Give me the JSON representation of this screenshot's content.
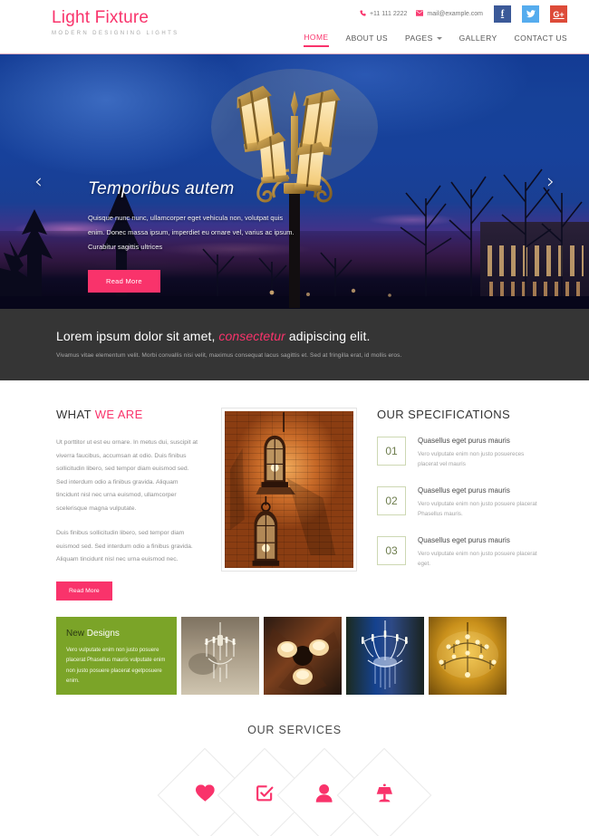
{
  "header": {
    "logo_title": "Light Fixture",
    "logo_tagline": "Modern Designing Lights",
    "phone": "+11 111 2222",
    "email": "mail@example.com",
    "phone_icon": "phone-icon",
    "email_icon": "envelope-icon",
    "social": [
      {
        "name": "facebook-icon",
        "glyph": "f"
      },
      {
        "name": "twitter-icon",
        "glyph": "ᵀ"
      },
      {
        "name": "google-plus-icon",
        "glyph": "G+"
      }
    ],
    "nav": [
      {
        "label": "HOME",
        "active": true
      },
      {
        "label": "ABOUT US",
        "active": false
      },
      {
        "label": "PAGES",
        "active": false,
        "has_dropdown": true
      },
      {
        "label": "GALLERY",
        "active": false
      },
      {
        "label": "CONTACT US",
        "active": false
      }
    ]
  },
  "slider": {
    "title": "Temporibus autem",
    "description": "Quisque nunc nunc, ullamcorper eget vehicula non, volutpat quis enim. Donec massa ipsum, imperdiet eu ornare vel, varius ac ipsum. Curabitur sagittis ultrices",
    "button": "Read More",
    "prev_arrow": "‹",
    "next_arrow": "›"
  },
  "banner": {
    "title_part1": "Lorem ipsum dolor sit amet, ",
    "title_emphasis": "consectetur",
    "title_part2": " adipiscing elit.",
    "subtitle": "Vivamus vitae elementum velit. Morbi convallis nisi velit, maximus consequat lacus sagittis et. Sed at fringilla erat, id mollis eros."
  },
  "about": {
    "title_part1": "WHAT ",
    "title_highlight": "WE ARE",
    "paragraph1": "Ut porttitor ut est eu ornare. In metus dui, suscipit at viverra faucibus, accumsan at odio. Duis finibus sollicitudin libero, sed tempor diam euismod sed. Sed interdum odio a finibus gravida. Aliquam tincidunt nisl nec urna euismod, ullamcorper scelerisque magna vulputate.",
    "paragraph2": "Duis finibus sollicitudin libero, sed tempor diam euismod sed. Sed interdum odio a finibus gravida. Aliquam tincidunt nisl nec urna euismod nec.",
    "button": "Read More",
    "image_alt": "hanging-lanterns-on-brick-wall"
  },
  "specifications": {
    "title": "OUR SPECIFICATIONS",
    "items": [
      {
        "num": "01",
        "heading": "Quasellus eget purus mauris",
        "text": "Vero vulputate enim non justo posuereces placerat vel mauris"
      },
      {
        "num": "02",
        "heading": "Quasellus eget purus mauris",
        "text": "Vero vulputate enim non justo posuere placerat Phasellus mauris."
      },
      {
        "num": "03",
        "heading": "Quasellus eget purus mauris",
        "text": "Vero vulputate enim non justo posuere placerat eget."
      }
    ]
  },
  "new_designs": {
    "title_dark": "New ",
    "title_light": "Designs",
    "text": "Vero vulputate enim non justo posuere placerat Phasellus mauris vulputate enim non justo posuere placerat egetposuere enim.",
    "thumbs": [
      {
        "alt": "crystal-chandelier-sepia"
      },
      {
        "alt": "ceiling-fan-light-wood"
      },
      {
        "alt": "crystal-chandelier-blue"
      },
      {
        "alt": "golden-chandelier"
      }
    ]
  },
  "services": {
    "title": "OUR SERVICES",
    "items": [
      {
        "icon": "heart-icon"
      },
      {
        "icon": "check-square-icon"
      },
      {
        "icon": "user-icon"
      },
      {
        "icon": "desk-lamp-icon"
      }
    ]
  },
  "colors": {
    "accent_pink": "#f9336b",
    "green": "#7ba428",
    "dark_banner": "#353535",
    "spec_border": "#cdd8b3"
  }
}
